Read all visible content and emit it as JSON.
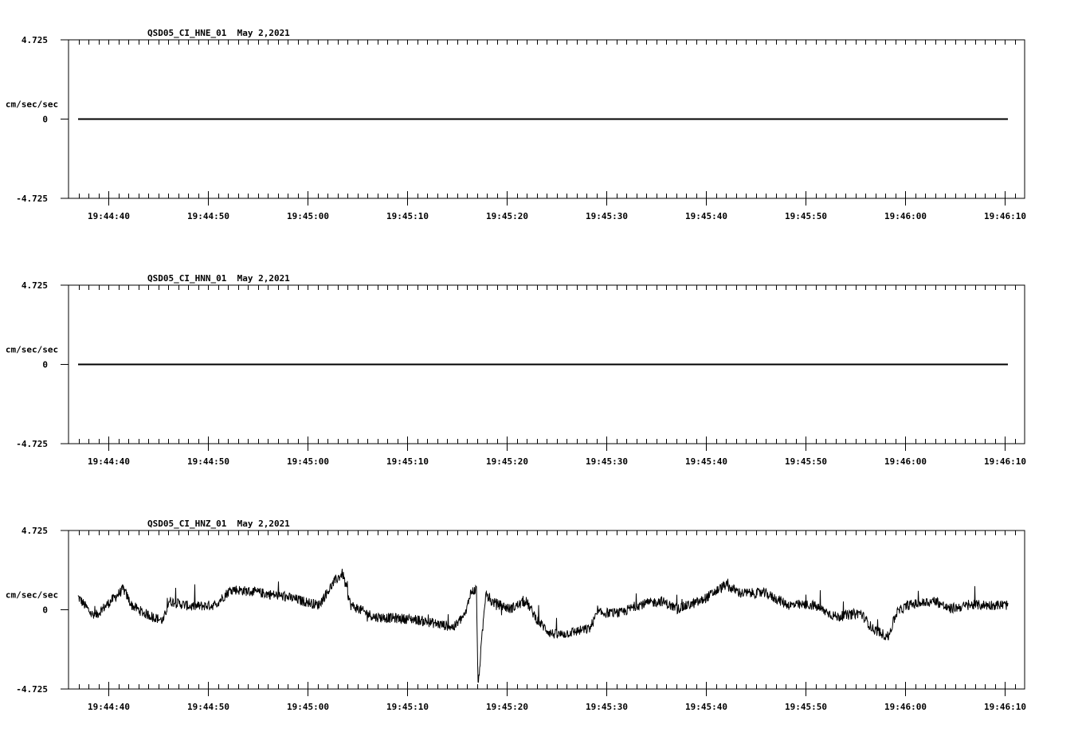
{
  "chart_data": [
    {
      "type": "line",
      "title": "QSD05_CI_HNE_01  May 2,2021",
      "ylabel": "cm/sec/sec",
      "ylim": [
        -4.725,
        4.725
      ],
      "y_ticks": [
        "4.725",
        "0",
        "-4.725"
      ],
      "x_start": "19:44:36",
      "x_range_seconds": [
        0,
        96
      ],
      "x_ticks": [
        "19:44:40",
        "19:44:50",
        "19:45:00",
        "19:45:10",
        "19:45:20",
        "19:45:30",
        "19:45:40",
        "19:45:50",
        "19:46:00",
        "19:46:10"
      ],
      "trace": {
        "flat": true,
        "t_start": 0.96,
        "t_end": 94.32,
        "value": 0,
        "noise": 0
      }
    },
    {
      "type": "line",
      "title": "QSD05_CI_HNN_01  May 2,2021",
      "ylabel": "cm/sec/sec",
      "ylim": [
        -4.725,
        4.725
      ],
      "y_ticks": [
        "4.725",
        "0",
        "-4.725"
      ],
      "x_start": "19:44:36",
      "x_range_seconds": [
        0,
        96
      ],
      "x_ticks": [
        "19:44:40",
        "19:44:50",
        "19:45:00",
        "19:45:10",
        "19:45:20",
        "19:45:30",
        "19:45:40",
        "19:45:50",
        "19:46:00",
        "19:46:10"
      ],
      "trace": {
        "flat": true,
        "t_start": 0.96,
        "t_end": 94.32,
        "value": 0,
        "noise": 0
      }
    },
    {
      "type": "line",
      "title": "QSD05_CI_HNZ_01  May 2,2021",
      "ylabel": "cm/sec/sec",
      "ylim": [
        -4.725,
        4.725
      ],
      "y_ticks": [
        "4.725",
        "0",
        "-4.725"
      ],
      "x_start": "19:44:36",
      "x_range_seconds": [
        0,
        96
      ],
      "x_ticks": [
        "19:44:40",
        "19:44:50",
        "19:45:00",
        "19:45:10",
        "19:45:20",
        "19:45:30",
        "19:45:40",
        "19:45:50",
        "19:46:00",
        "19:46:10"
      ],
      "trace": {
        "flat": false,
        "noise": 0.3,
        "points": [
          [
            0.96,
            0.76
          ],
          [
            2.56,
            -0.43
          ],
          [
            5.52,
            1.23
          ],
          [
            6.32,
            0.28
          ],
          [
            7.52,
            -0.19
          ],
          [
            9.52,
            -0.66
          ],
          [
            10.08,
            0.52
          ],
          [
            12.32,
            0.19
          ],
          [
            14.72,
            0.28
          ],
          [
            16.32,
            1.23
          ],
          [
            19.52,
            0.99
          ],
          [
            21.92,
            0.76
          ],
          [
            25.12,
            0.28
          ],
          [
            26.72,
            1.7
          ],
          [
            27.52,
            2.17
          ],
          [
            28.32,
            0.28
          ],
          [
            30.72,
            -0.43
          ],
          [
            34.72,
            -0.57
          ],
          [
            38.72,
            -1.04
          ],
          [
            39.92,
            -0.19
          ],
          [
            40.32,
            0.99
          ],
          [
            40.96,
            1.23
          ],
          [
            41.12,
            -4.6
          ],
          [
            41.52,
            -1.61
          ],
          [
            41.92,
            1.23
          ],
          [
            42.32,
            0.52
          ],
          [
            44.32,
            0.05
          ],
          [
            45.92,
            0.52
          ],
          [
            47.12,
            -0.66
          ],
          [
            48.32,
            -1.37
          ],
          [
            49.12,
            -1.51
          ],
          [
            52.32,
            -1.13
          ],
          [
            53.12,
            -0.19
          ],
          [
            55.52,
            -0.19
          ],
          [
            57.12,
            0.28
          ],
          [
            59.52,
            0.52
          ],
          [
            61.12,
            0.05
          ],
          [
            63.52,
            0.52
          ],
          [
            65.92,
            1.46
          ],
          [
            67.52,
            0.99
          ],
          [
            69.92,
            0.99
          ],
          [
            72.32,
            0.28
          ],
          [
            74.72,
            0.28
          ],
          [
            77.12,
            -0.43
          ],
          [
            79.52,
            -0.19
          ],
          [
            80.72,
            -1.13
          ],
          [
            82.32,
            -1.61
          ],
          [
            83.12,
            -0.19
          ],
          [
            84.32,
            0.28
          ],
          [
            87.12,
            0.52
          ],
          [
            88.32,
            0.05
          ],
          [
            90.72,
            0.28
          ],
          [
            94.32,
            0.28
          ]
        ]
      }
    }
  ]
}
